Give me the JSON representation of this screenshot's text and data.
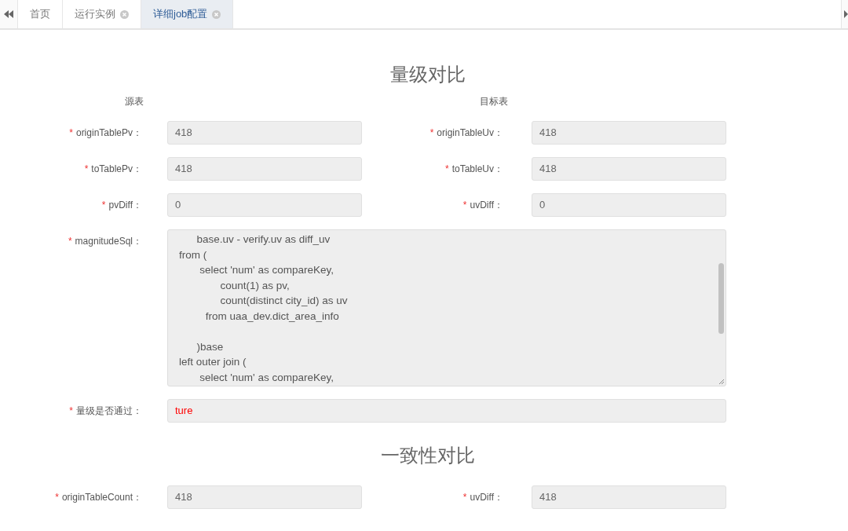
{
  "tabs": [
    {
      "label": "首页",
      "selected": false,
      "closable": false
    },
    {
      "label": "运行实例",
      "selected": false,
      "closable": true
    },
    {
      "label": "详细job配置",
      "selected": true,
      "closable": true
    }
  ],
  "sections": [
    {
      "title": "量级对比",
      "headers": [
        "源表",
        "目标表"
      ],
      "rows": [
        {
          "kind": "pair",
          "fields": [
            {
              "required_mark": "*",
              "label": "originTablePv：",
              "value": "418",
              "alert": false
            },
            {
              "required_mark": "*",
              "label": "originTableUv：",
              "value": "418",
              "alert": false
            }
          ]
        },
        {
          "kind": "pair",
          "fields": [
            {
              "required_mark": "*",
              "label": "toTablePv：",
              "value": "418",
              "alert": false
            },
            {
              "required_mark": "*",
              "label": "toTableUv：",
              "value": "418",
              "alert": false
            }
          ]
        },
        {
          "kind": "pair",
          "fields": [
            {
              "required_mark": "*",
              "label": "pvDiff：",
              "value": "0",
              "alert": false
            },
            {
              "required_mark": "*",
              "label": "uvDiff：",
              "value": "0",
              "alert": false
            }
          ]
        },
        {
          "kind": "code",
          "fields": [
            {
              "required_mark": "*",
              "label": "magnitudeSql：",
              "lines": [
                {
                  "text": "      base.uv - verify.uv as diff_uv",
                  "gap_before": false
                },
                {
                  "text": "from (",
                  "gap_before": false
                },
                {
                  "text": "       select 'num' as compareKey,",
                  "gap_before": false
                },
                {
                  "text": "              count(1) as pv,",
                  "gap_before": false
                },
                {
                  "text": "              count(distinct city_id) as uv",
                  "gap_before": false
                },
                {
                  "text": "         from uaa_dev.dict_area_info",
                  "gap_before": false
                },
                {
                  "text": "      )base",
                  "gap_before": true
                },
                {
                  "text": "left outer join (",
                  "gap_before": false
                },
                {
                  "text": "       select 'num' as compareKey,",
                  "gap_before": false
                }
              ]
            }
          ]
        },
        {
          "kind": "wide",
          "fields": [
            {
              "required_mark": "*",
              "label": "量级是否通过：",
              "value": "ture",
              "alert": true
            }
          ]
        }
      ]
    },
    {
      "title": "一致性对比",
      "rows": [
        {
          "kind": "pair",
          "fields": [
            {
              "required_mark": "*",
              "label": "originTableCount：",
              "value": "418",
              "alert": false
            },
            {
              "required_mark": "*",
              "label": "uvDiff：",
              "value": "418",
              "alert": false
            }
          ]
        }
      ]
    }
  ]
}
